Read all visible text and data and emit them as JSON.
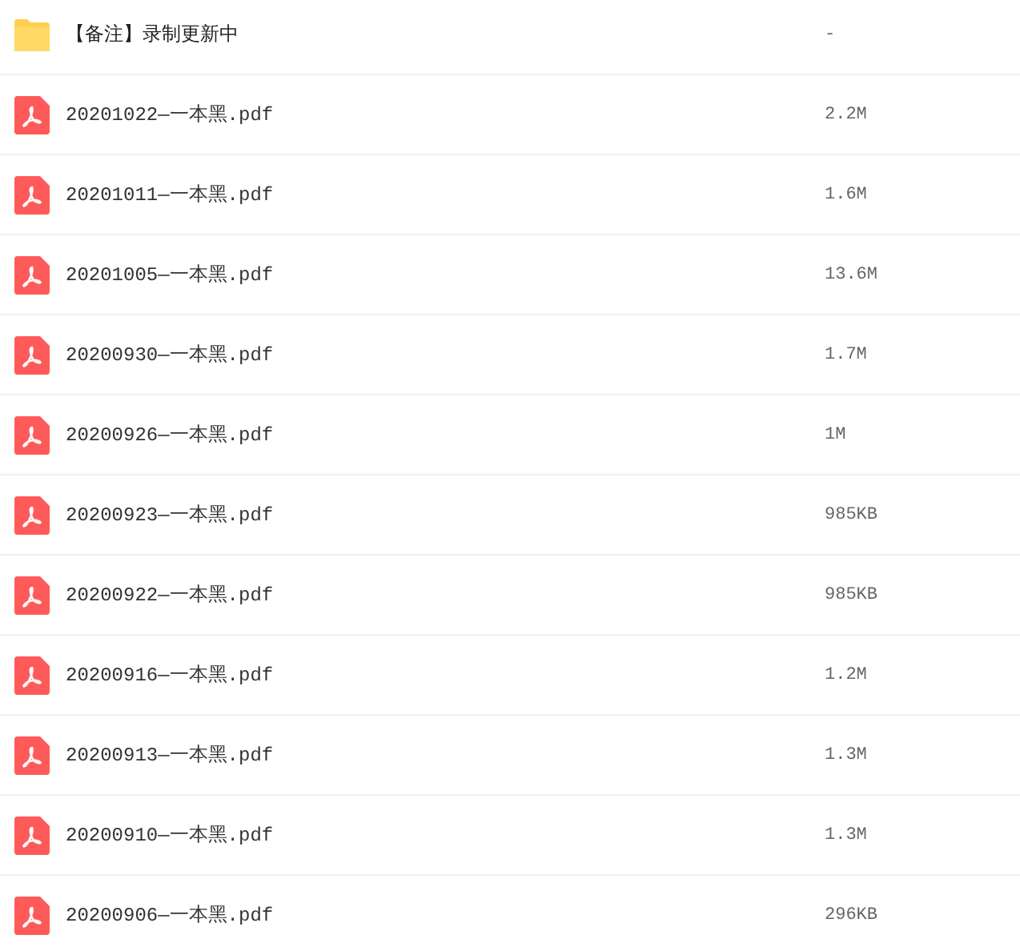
{
  "files": [
    {
      "kind": "folder",
      "name": "【备注】录制更新中",
      "size": "-"
    },
    {
      "kind": "pdf",
      "name": "20201022—一本黑.pdf",
      "size": "2.2M"
    },
    {
      "kind": "pdf",
      "name": "20201011—一本黑.pdf",
      "size": "1.6M"
    },
    {
      "kind": "pdf",
      "name": "20201005—一本黑.pdf",
      "size": "13.6M"
    },
    {
      "kind": "pdf",
      "name": "20200930—一本黑.pdf",
      "size": "1.7M"
    },
    {
      "kind": "pdf",
      "name": "20200926—一本黑.pdf",
      "size": "1M"
    },
    {
      "kind": "pdf",
      "name": "20200923—一本黑.pdf",
      "size": "985KB"
    },
    {
      "kind": "pdf",
      "name": "20200922—一本黑.pdf",
      "size": "985KB"
    },
    {
      "kind": "pdf",
      "name": "20200916—一本黑.pdf",
      "size": "1.2M"
    },
    {
      "kind": "pdf",
      "name": "20200913—一本黑.pdf",
      "size": "1.3M"
    },
    {
      "kind": "pdf",
      "name": "20200910—一本黑.pdf",
      "size": "1.3M"
    },
    {
      "kind": "pdf",
      "name": "20200906—一本黑.pdf",
      "size": "296KB"
    }
  ]
}
